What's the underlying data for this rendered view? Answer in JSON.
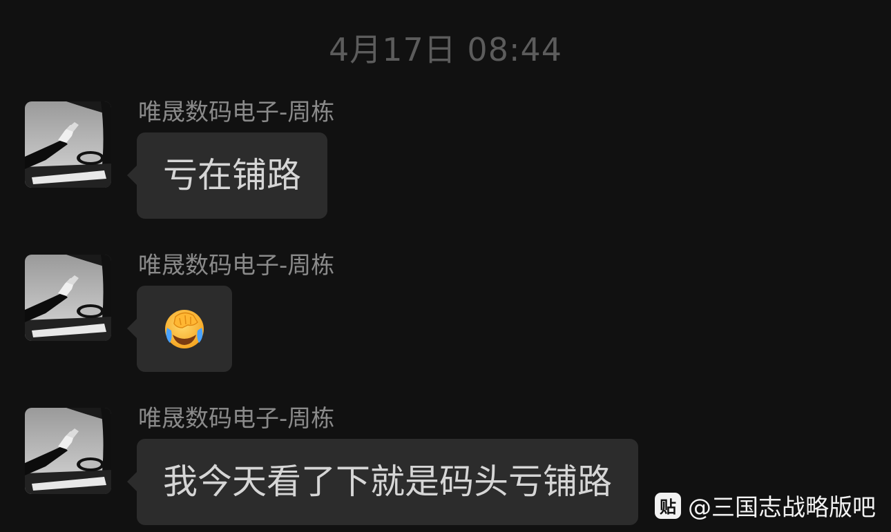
{
  "timestamp": "4月17日 08:44",
  "messages": [
    {
      "sender": "唯晟数码电子-周栋",
      "text": "亏在铺路",
      "type": "text"
    },
    {
      "sender": "唯晟数码电子-周栋",
      "emoji": "facepalm-crying-emoji",
      "type": "emoji"
    },
    {
      "sender": "唯晟数码电子-周栋",
      "text": "我今天看了下就是码头亏铺路",
      "type": "text"
    }
  ],
  "watermark": {
    "badge": "贴",
    "text": "@三国志战略版吧"
  },
  "colors": {
    "background": "#111111",
    "bubble": "#2c2c2c",
    "bubble_text": "#d6d6d6",
    "sender_text": "#8a8a8a",
    "timestamp_text": "#5c5c5c"
  }
}
